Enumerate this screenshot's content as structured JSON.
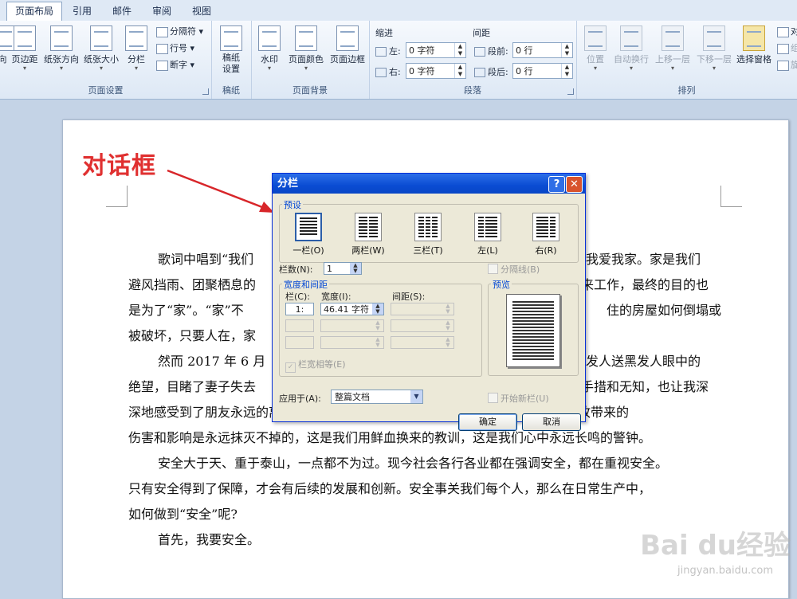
{
  "tabs": [
    "页面布局",
    "引用",
    "邮件",
    "审阅",
    "视图"
  ],
  "active_tab": "页面布局",
  "groups": {
    "page_setup": {
      "label": "页面设置",
      "buttons": [
        "向",
        "页边距",
        "纸张方向",
        "纸张大小",
        "分栏"
      ],
      "small": [
        "分隔符",
        "行号",
        "断字"
      ]
    },
    "manuscript": {
      "label": "稿纸",
      "button": "稿纸设置"
    },
    "page_background": {
      "label": "页面背景",
      "buttons": [
        "水印",
        "页面颜色",
        "页面边框"
      ]
    },
    "paragraph": {
      "label": "段落",
      "indent_label": "缩进",
      "spacing_label": "间距",
      "left_label": "左:",
      "left_value": "0 字符",
      "right_label": "右:",
      "right_value": "0 字符",
      "before_label": "段前:",
      "before_value": "0 行",
      "after_label": "段后:",
      "after_value": "0 行"
    },
    "arrange": {
      "label": "排列",
      "buttons": [
        "位置",
        "自动换行",
        "上移一层",
        "下移一层",
        "选择窗格"
      ],
      "small": [
        "对",
        "组",
        "旋"
      ]
    }
  },
  "annotation": "对话框",
  "document": {
    "paragraphs": [
      [
        "歌词中唱到“我们",
        "我爱我家。家是我们"
      ],
      [
        "避风挡雨、团聚栖息的",
        "来工作，最终的目的也"
      ],
      [
        "是为了“家”。“家”不",
        "住的房屋如何倒塌或"
      ],
      [
        "被破坏，只要人在，家"
      ],
      [
        "然而 2017 年 6 月",
        "发人送黑发人眼中的"
      ],
      [
        "绝望，目睹了妻子失去",
        "手措和无知，也让我深"
      ],
      [
        "深地感受到了朋友永远的离开。对于“6·23”事故的对与错我们暂且不论，但是事故带来的"
      ],
      [
        "伤害和影响是永远抹灭不掉的，这是我们用鲜血换来的教训，这是我们心中永远长鸣的警钟。"
      ],
      [
        "安全大于天、重于泰山，一点都不为过。现今社会各行各业都在强调安全，都在重视安全。"
      ],
      [
        "只有安全得到了保障，才会有后续的发展和创新。安全事关我们每个人，那么在日常生产中，"
      ],
      [
        "如何做到“安全”呢?"
      ],
      [
        "首先，我要安全。"
      ]
    ]
  },
  "dialog": {
    "title": "分栏",
    "help": "?",
    "close": "✕",
    "presets_label": "预设",
    "presets": [
      "一栏(O)",
      "两栏(W)",
      "三栏(T)",
      "左(L)",
      "右(R)"
    ],
    "selected_preset": "一栏(O)",
    "num_cols_label": "栏数(N):",
    "num_cols_value": "1",
    "separator_label": "分隔线(B)",
    "width_spacing_label": "宽度和间距",
    "preview_label": "预览",
    "col_header": "栏(C):",
    "width_header": "宽度(I):",
    "spacing_header": "间距(S):",
    "row1_col": "1:",
    "row1_width": "46.41 字符",
    "equal_width_label": "栏宽相等(E)",
    "apply_to_label": "应用于(A):",
    "apply_to_value": "整篇文档",
    "new_column_label": "开始新栏(U)",
    "ok": "确定",
    "cancel": "取消"
  },
  "watermark": {
    "main": "Bai du经验",
    "sub": "jingyan.baidu.com"
  }
}
